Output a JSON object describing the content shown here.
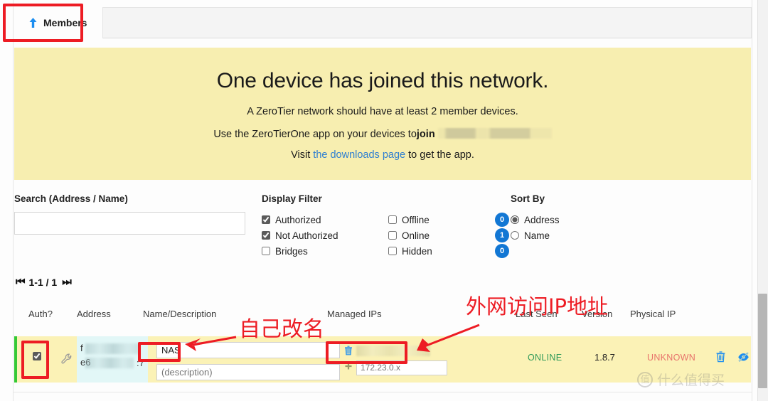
{
  "tab": {
    "label": "Members",
    "icon": "arrow-up-icon"
  },
  "alert": {
    "heading": "One device has joined this network.",
    "line1": "A ZeroTier network should have at least 2 member devices.",
    "line2_prefix": "Use the ZeroTierOne app on your devices to ",
    "line2_bold": "join",
    "line2_redacted": "████████████████",
    "line3_prefix": "Visit ",
    "line3_link": "the downloads page",
    "line3_suffix": " to get the app."
  },
  "search": {
    "label": "Search (Address / Name)",
    "value": "",
    "placeholder": ""
  },
  "display_filter": {
    "label": "Display Filter",
    "left": [
      {
        "label": "Authorized",
        "checked": true
      },
      {
        "label": "Not Authorized",
        "checked": true
      },
      {
        "label": "Bridges",
        "checked": false
      }
    ],
    "right": [
      {
        "label": "Offline",
        "checked": false,
        "count": "0"
      },
      {
        "label": "Online",
        "checked": false,
        "count": "1"
      },
      {
        "label": "Hidden",
        "checked": false,
        "count": "0"
      }
    ]
  },
  "sort_by": {
    "label": "Sort By",
    "options": [
      {
        "label": "Address",
        "selected": true
      },
      {
        "label": "Name",
        "selected": false
      }
    ]
  },
  "pager": {
    "first": "⏮",
    "range": "1-1 / 1",
    "last": "⏭"
  },
  "table": {
    "headers": [
      "Auth?",
      "Address",
      "Name/Description",
      "Managed IPs",
      "Last Seen",
      "Version",
      "Physical IP"
    ],
    "rows": [
      {
        "auth_checked": true,
        "config_icon": "wrench-icon",
        "address_line1": "f",
        "address_line2": "e6",
        "address_line2_suffix": ":7",
        "name": "NAS",
        "description_placeholder": "(description)",
        "managed_ip_delete_icon": "trash-icon",
        "managed_ip_add_icon": "plus-icon",
        "managed_ip_input_placeholder": "172.23.0.x",
        "last_seen": "ONLINE",
        "version": "1.8.7",
        "physical_ip": "UNKNOWN",
        "action_delete_icon": "trash-icon",
        "action_hide_icon": "eye-slash-icon"
      }
    ]
  },
  "annotations": {
    "rename_note": "自己改名",
    "external_ip_note": "外网访问IP地址"
  },
  "watermark": {
    "mark": "值",
    "text": "什么值得买"
  },
  "colors": {
    "accent": "#1277d4",
    "annotation": "#ed1c24",
    "alert_bg": "#f7eeb0",
    "row_bg": "#fbf2b6",
    "online": "#2f9a58",
    "unknown": "#e8736b",
    "authorized_stripe": "#35c935"
  }
}
